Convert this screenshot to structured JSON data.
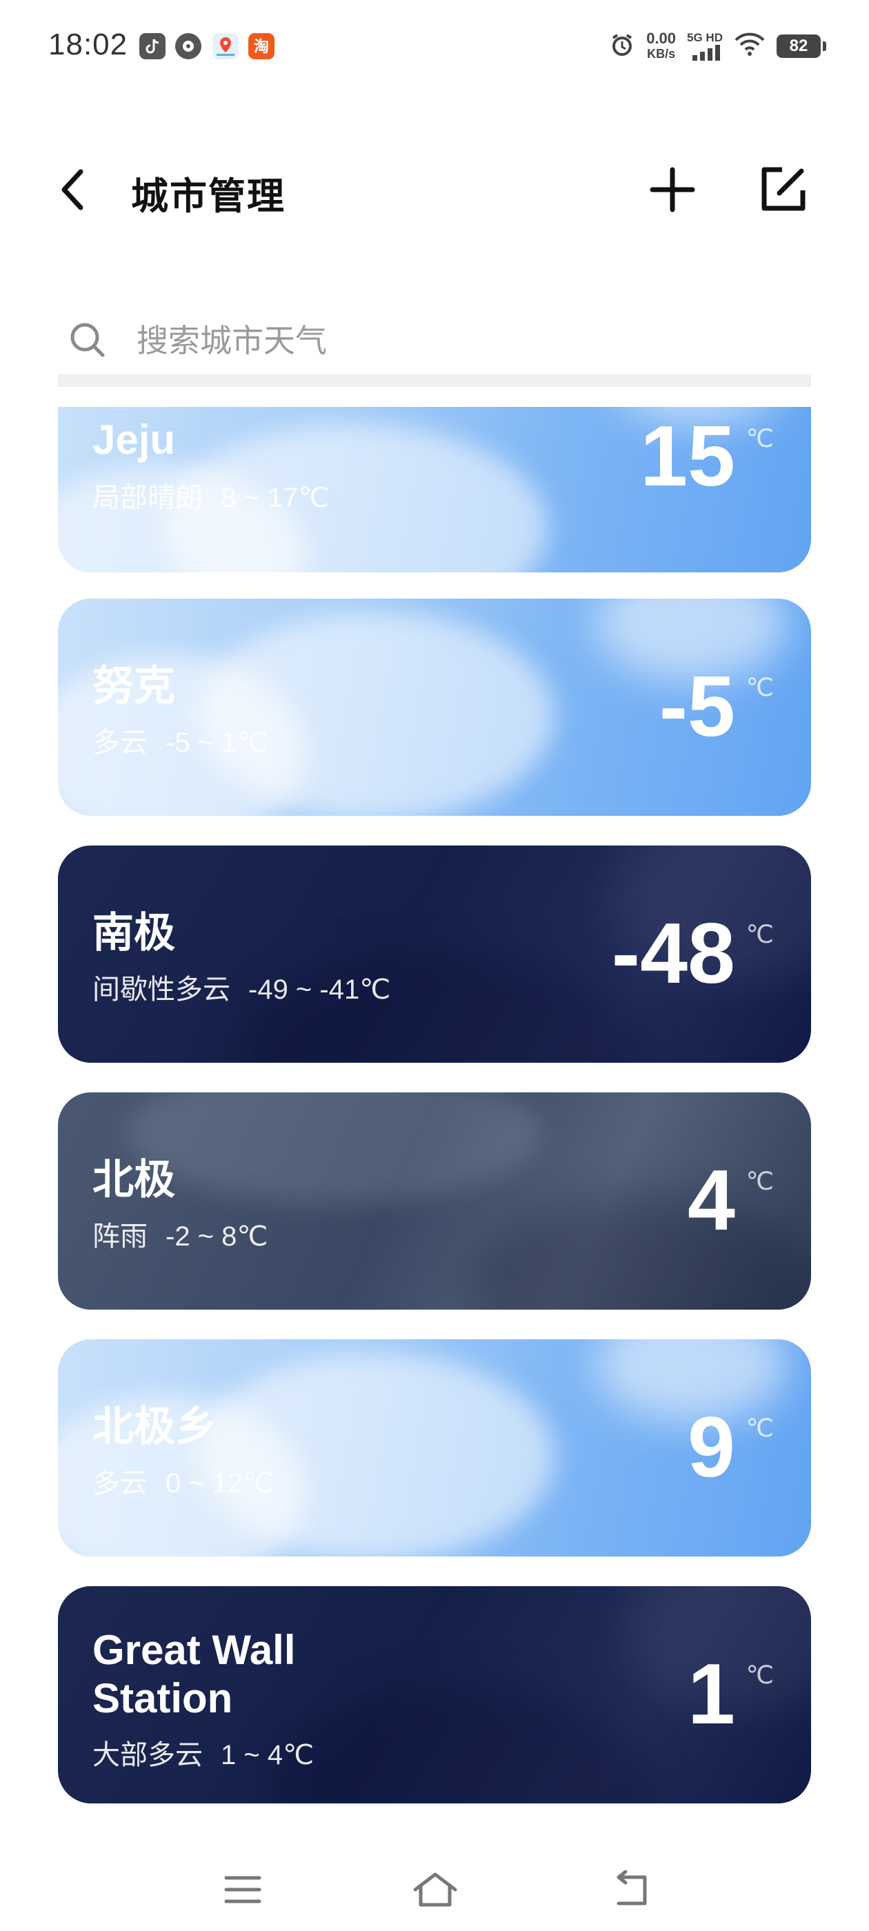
{
  "status_bar": {
    "time": "18:02",
    "net_speed_value": "0.00",
    "net_speed_unit": "KB/s",
    "network_type": "5G HD",
    "battery": "82"
  },
  "header": {
    "title": "城市管理"
  },
  "search": {
    "placeholder": "搜索城市天气"
  },
  "cities": [
    {
      "name": "Jeju",
      "condition": "局部晴朗",
      "range": "8 ~ 17℃",
      "temp": "15",
      "unit": "℃",
      "style": "bright"
    },
    {
      "name": "努克",
      "condition": "多云",
      "range": "-5 ~ 1℃",
      "temp": "-5",
      "unit": "℃",
      "style": "bright"
    },
    {
      "name": "南极",
      "condition": "间歇性多云",
      "range": "-49 ~ -41℃",
      "temp": "-48",
      "unit": "℃",
      "style": "dark"
    },
    {
      "name": "北极",
      "condition": "阵雨",
      "range": "-2 ~ 8℃",
      "temp": "4",
      "unit": "℃",
      "style": "rain"
    },
    {
      "name": "北极乡",
      "condition": "多云",
      "range": "0 ~ 12℃",
      "temp": "9",
      "unit": "℃",
      "style": "bright"
    },
    {
      "name": "Great Wall Station",
      "name_line1": "Great Wall",
      "name_line2": "Station",
      "condition": "大部多云",
      "range": "1 ~ 4℃",
      "temp": "1",
      "unit": "℃",
      "style": "dark"
    }
  ],
  "colors": {
    "bright_card": "#7fb6f5",
    "dark_card": "#15204a",
    "rain_card": "#3a4864"
  }
}
